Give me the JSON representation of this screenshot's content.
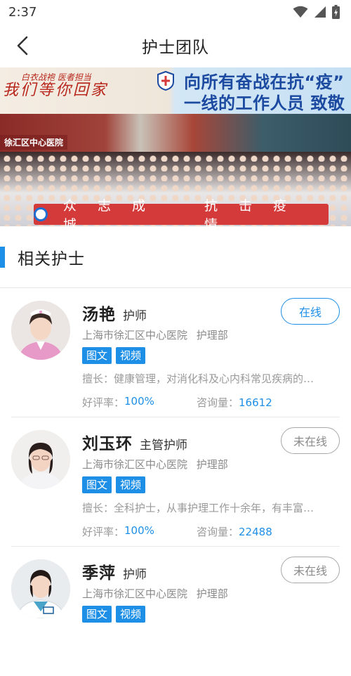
{
  "status_bar": {
    "time": "2:37"
  },
  "header": {
    "title": "护士团队"
  },
  "banner": {
    "left_line1": "白衣战袍  医者担当",
    "left_line2": "我们等你回家",
    "right_line1": "向所有奋战在抗“疫”",
    "right_line2": "一线的工作人员 致敬",
    "hospital_sign": "徐汇区中心医院",
    "slogan_1": "众 志 成 城",
    "slogan_2": "抗 击 疫 情"
  },
  "section": {
    "title": "相关护士"
  },
  "nurses": [
    {
      "name": "汤艳",
      "title": "护师",
      "hospital": "上海市徐汇区中心医院",
      "department": "护理部",
      "tag_text": "图文",
      "tag_video": "视频",
      "specialty": "擅长：健康管理，对消化科及心内科常见疾病的…",
      "rating_label": "好评率：",
      "rating_value": "100%",
      "consult_label": "咨询量：",
      "consult_value": "16612",
      "status": "在线"
    },
    {
      "name": "刘玉环",
      "title": "主管护师",
      "hospital": "上海市徐汇区中心医院",
      "department": "护理部",
      "tag_text": "图文",
      "tag_video": "视频",
      "specialty": "擅长：全科护士，从事护理工作十余年，有丰富…",
      "rating_label": "好评率：",
      "rating_value": "100%",
      "consult_label": "咨询量：",
      "consult_value": "22488",
      "status": "未在线"
    },
    {
      "name": "季萍",
      "title": "护师",
      "hospital": "上海市徐汇区中心医院",
      "department": "护理部",
      "tag_text": "图文",
      "tag_video": "视频",
      "status": "未在线"
    }
  ],
  "colors": {
    "accent": "#1e8fe6",
    "offline_border": "#a8a8a8",
    "muted_text": "#9a9a9a"
  }
}
